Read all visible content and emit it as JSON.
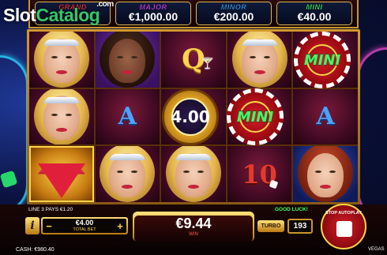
{
  "logo": {
    "part_a": "Slot",
    "part_b": "Catalog",
    "suffix": ".com"
  },
  "jackpots": [
    {
      "name": "GRAND",
      "value": ""
    },
    {
      "name": "MAJOR",
      "value": "€1,000.00"
    },
    {
      "name": "MINOR",
      "value": "€200.00"
    },
    {
      "name": "MINI",
      "value": "€40.00"
    }
  ],
  "reels": {
    "row1": [
      "lady-blonde",
      "lady-dark",
      "Q",
      "lady-blonde",
      "mini-chip"
    ],
    "row2": [
      "lady-blonde",
      "A",
      "gold-chip",
      "mini-chip",
      "A"
    ],
    "row3": [
      "diamond",
      "lady-blonde",
      "lady-blonde",
      "10",
      "lady-red"
    ],
    "letters": {
      "q": "Q",
      "a": "A",
      "ten": "10"
    }
  },
  "chips": {
    "mini_label": "MINI",
    "gold_value": "4.00"
  },
  "footer": {
    "win_line": "LINE 3 PAYS €1.20",
    "good_luck": "GOOD LUCK!",
    "info_label": "i",
    "bet_minus": "−",
    "bet_plus": "+",
    "bet_amount": "€4.00",
    "bet_label": "TOTAL BET",
    "win_amount": "€9.44",
    "win_label": "WIN",
    "turbo_label": "TURBO",
    "autoplay_count": "193",
    "autoplay_label": "STOP AUTOPLAY",
    "cash": "CASH: €980.40",
    "vegas": "VEGAS"
  },
  "colors": {
    "grand": "#ff3b3b",
    "major": "#d64cff",
    "minor": "#39a6ff",
    "mini": "#3dff6a",
    "frame_gold": "#c9962b"
  }
}
